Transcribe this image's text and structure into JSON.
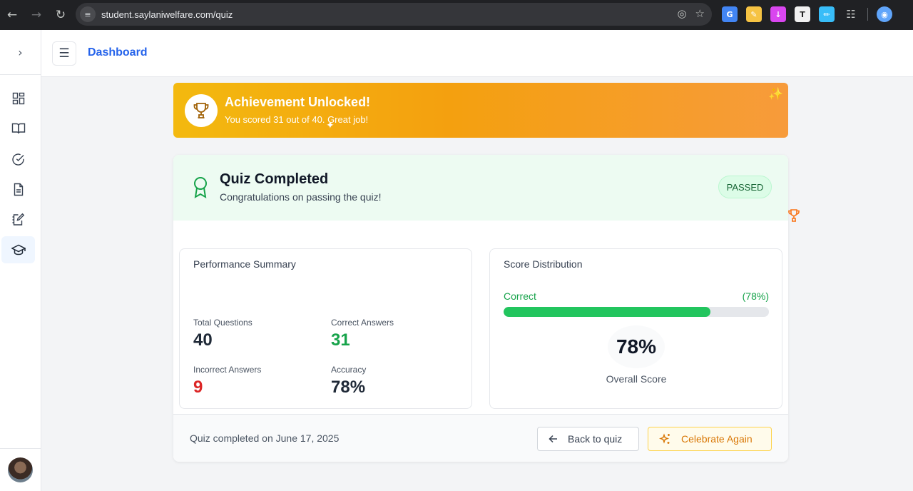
{
  "browser": {
    "url": "student.saylaniwelfare.com/quiz"
  },
  "header": {
    "title": "Dashboard"
  },
  "rail": {
    "items": [
      "dashboard-icon",
      "book-icon",
      "check-circle-icon",
      "document-icon",
      "notebook-pen-icon",
      "graduation-cap-icon"
    ],
    "active_item": "graduation-cap-icon"
  },
  "banner": {
    "title": "Achievement Unlocked!",
    "subtitle": "You scored 31 out of 40. Great job!"
  },
  "result": {
    "title": "Quiz Completed",
    "subtitle": "Congratulations on passing the quiz!",
    "badge": "PASSED"
  },
  "performance": {
    "title": "Performance Summary",
    "total_label": "Total Questions",
    "total_value": "40",
    "correct_label": "Correct Answers",
    "correct_value": "31",
    "incorrect_label": "Incorrect Answers",
    "incorrect_value": "9",
    "accuracy_label": "Accuracy",
    "accuracy_value": "78%"
  },
  "distribution": {
    "title": "Score Distribution",
    "correct_label": "Correct",
    "correct_percent": "(78%)",
    "fill_fraction": 0.78,
    "score": "78%",
    "score_label": "Overall Score"
  },
  "footer": {
    "completed_text": "Quiz completed on June 17, 2025",
    "back_label": "Back to quiz",
    "celebrate_label": "Celebrate Again"
  },
  "colors": {
    "accent": "#2563eb",
    "success": "#16a34a",
    "danger": "#dc2626",
    "banner_start": "#f3b90f",
    "banner_end": "#f79b3b"
  }
}
